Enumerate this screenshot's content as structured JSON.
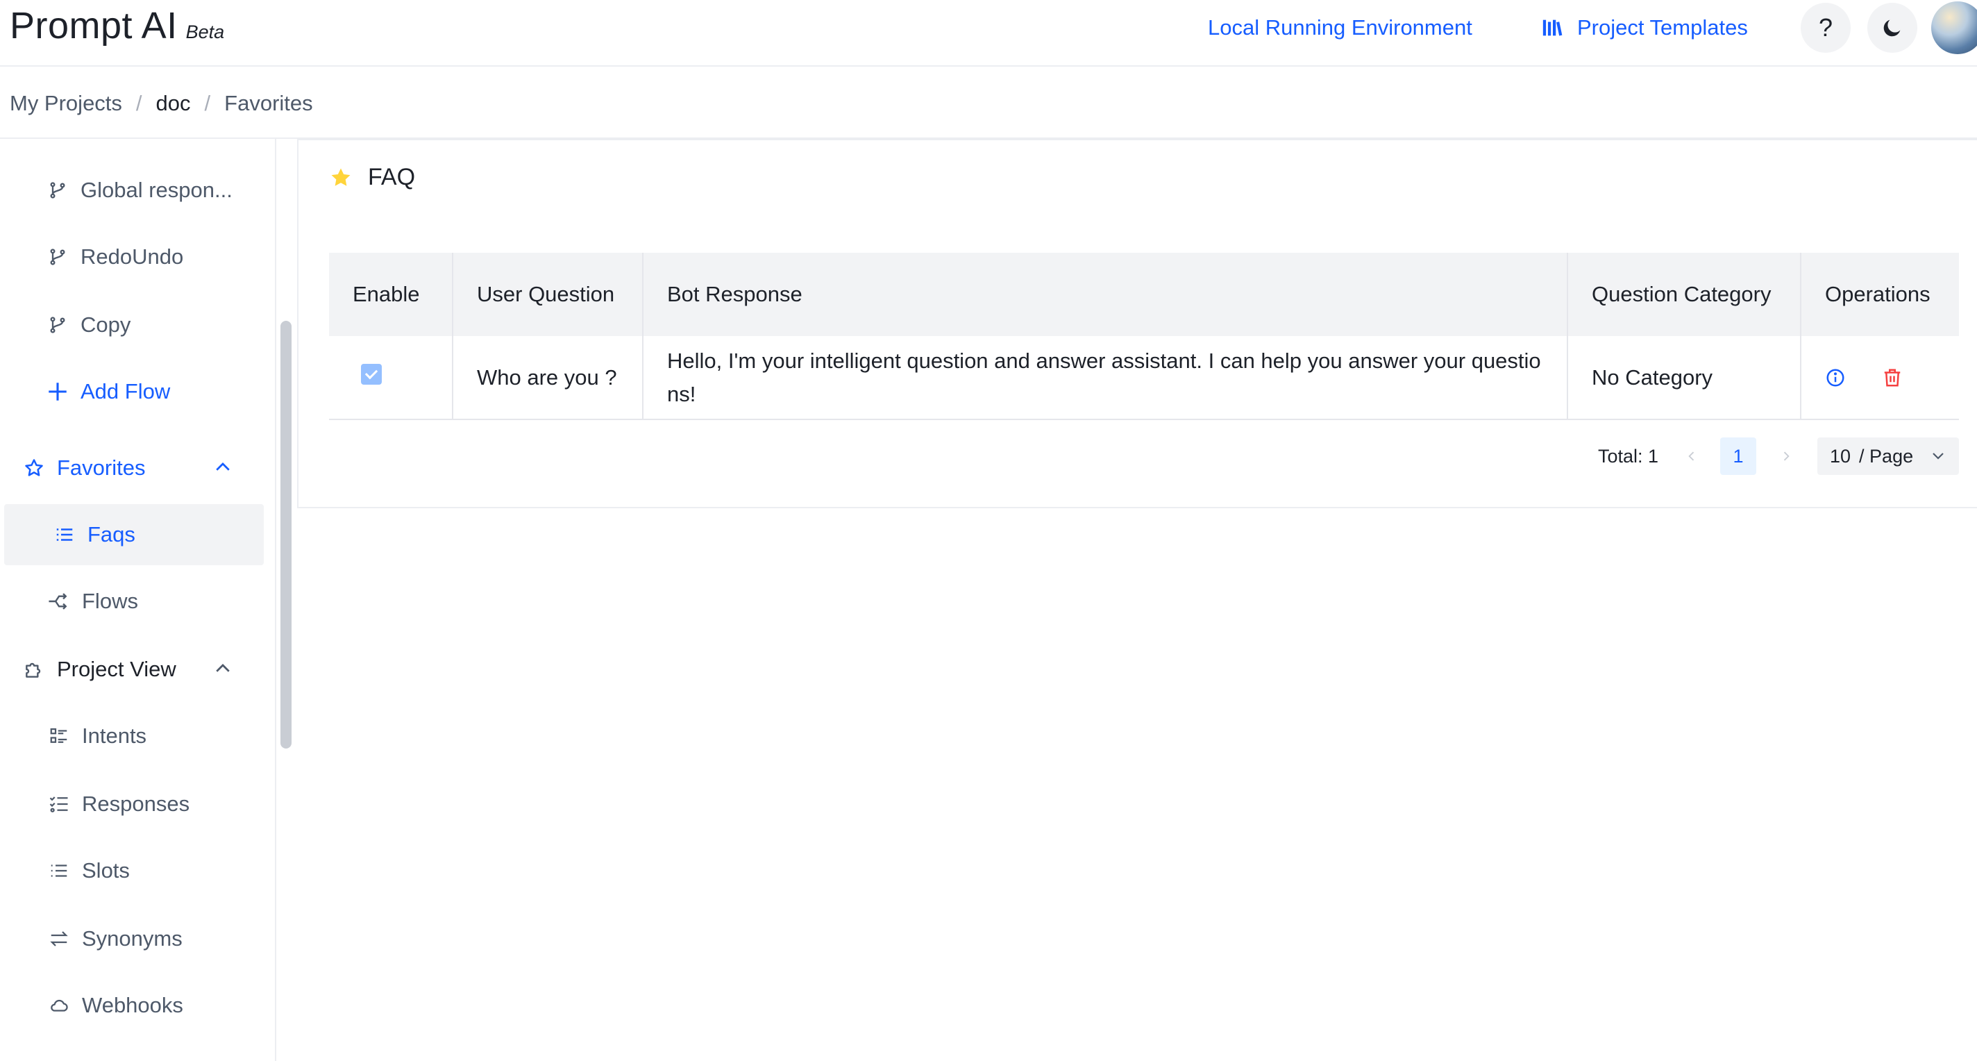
{
  "app": {
    "name": "Prompt AI",
    "badge": "Beta"
  },
  "header": {
    "env_link": "Local Running Environment",
    "templates_link": "Project Templates",
    "help_label": "?"
  },
  "breadcrumb": [
    "My Projects",
    "doc",
    "Favorites"
  ],
  "sidebar": {
    "flows": [
      {
        "label": "Global respon...",
        "icon": "branch-icon"
      },
      {
        "label": "RedoUndo",
        "icon": "branch-icon"
      },
      {
        "label": "Copy",
        "icon": "branch-icon"
      }
    ],
    "add_flow": "Add Flow",
    "favorites": {
      "label": "Favorites",
      "expanded": true,
      "items": [
        {
          "label": "Faqs",
          "icon": "list-icon",
          "selected": true
        },
        {
          "label": "Flows",
          "icon": "flows-icon",
          "selected": false
        }
      ]
    },
    "project_view": {
      "label": "Project View",
      "expanded": true,
      "items": [
        {
          "label": "Intents",
          "icon": "intents-icon"
        },
        {
          "label": "Responses",
          "icon": "responses-icon"
        },
        {
          "label": "Slots",
          "icon": "slots-icon"
        },
        {
          "label": "Synonyms",
          "icon": "synonyms-icon"
        },
        {
          "label": "Webhooks",
          "icon": "cloud-icon"
        }
      ]
    }
  },
  "main": {
    "title": "FAQ",
    "table": {
      "headers": [
        "Enable",
        "User Question",
        "Bot Response",
        "Question Category",
        "Operations"
      ],
      "rows": [
        {
          "enabled": true,
          "question": "Who are you ?",
          "response": "Hello, I'm your intelligent question and answer assistant. I can help you answer your questions!",
          "category": "No Category"
        }
      ]
    },
    "pagination": {
      "total": "Total: 1",
      "current_page": "1",
      "page_size": "10",
      "page_size_suffix": "/ Page"
    }
  },
  "colors": {
    "accent": "#165dff",
    "danger": "#f53f3f",
    "selected_bg": "#f2f3f5",
    "header_bg": "#f2f3f5",
    "star": "#ffd43b"
  }
}
